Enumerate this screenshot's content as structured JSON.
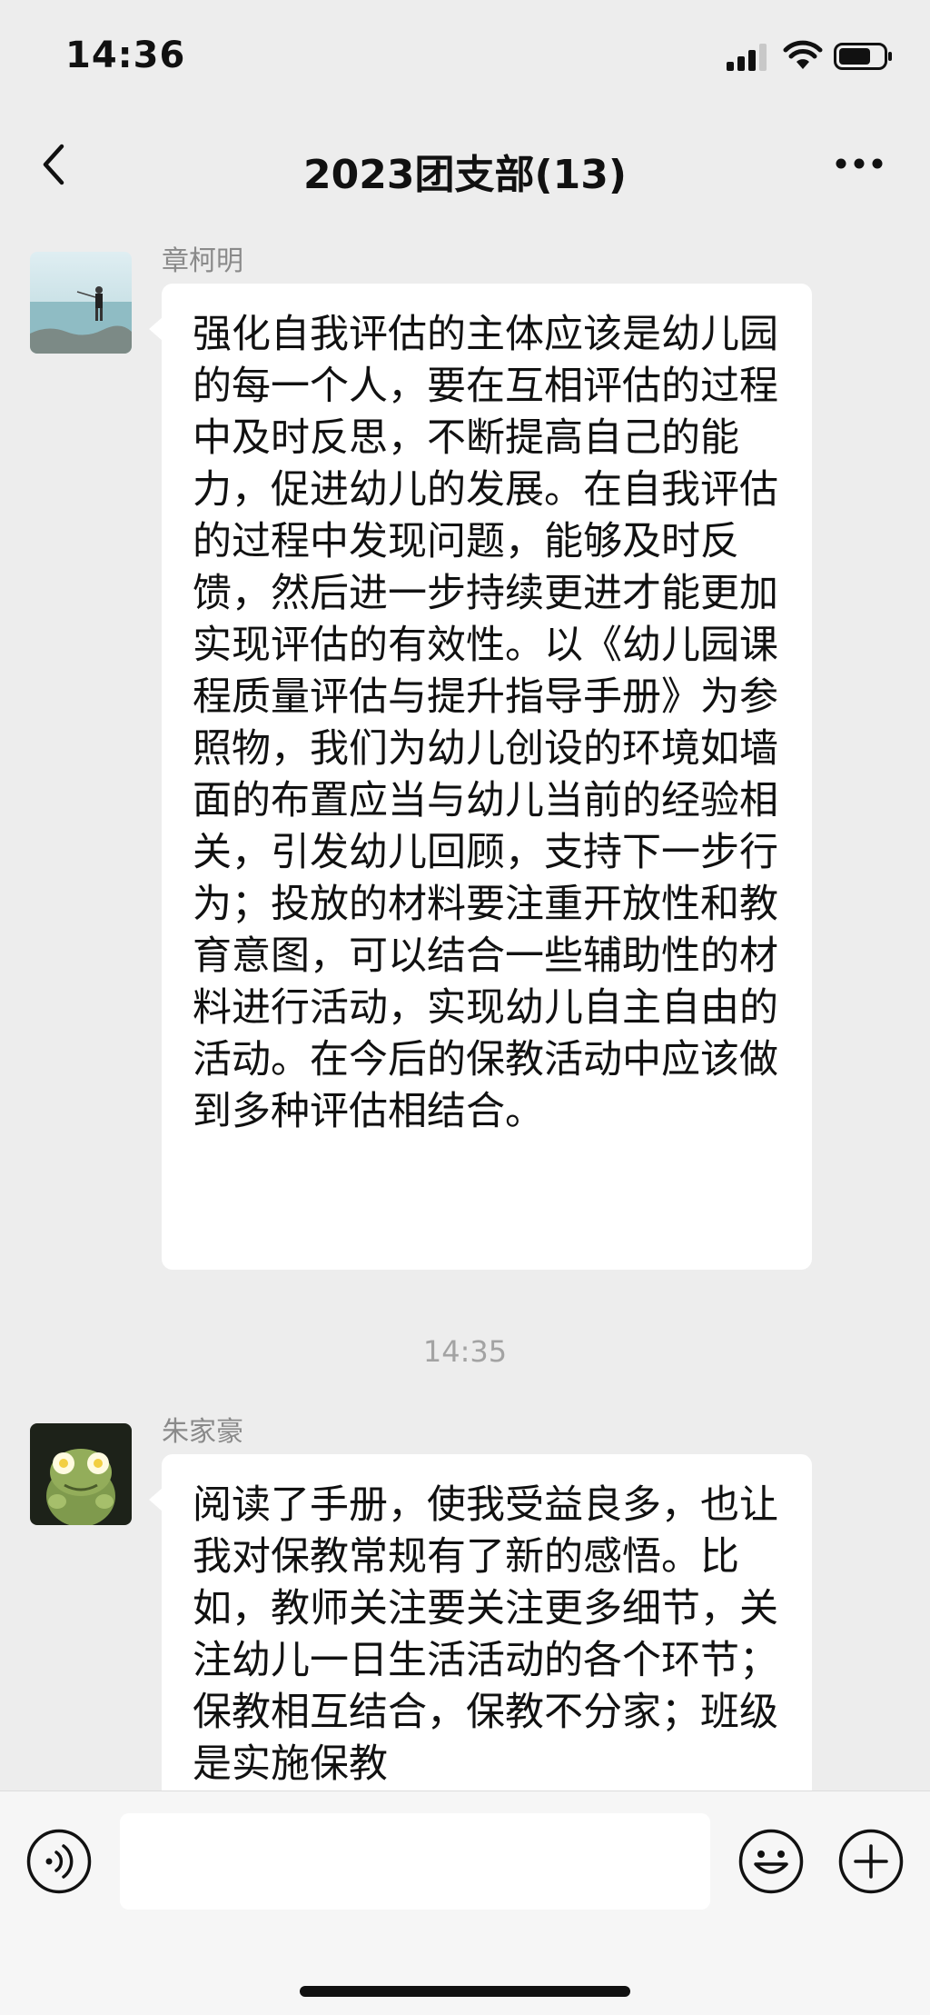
{
  "status_bar": {
    "time": "14:36"
  },
  "header": {
    "title": "2023团支部(13)"
  },
  "messages": [
    {
      "sender": "章柯明",
      "text": "强化自我评估的主体应该是幼儿园的每一个人，要在互相评估的过程中及时反思，不断提高自己的能力，促进幼儿的发展。在自我评估的过程中发现问题，能够及时反馈，然后进一步持续更进才能更加实现评估的有效性。以《幼儿园课程质量评估与提升指导手册》为参照物，我们为幼儿创设的环境如墙面的布置应当与幼儿当前的经验相关，引发幼儿回顾，支持下一步行为；投放的材料要注重开放性和教育意图，可以结合一些辅助性的材料进行活动，实现幼儿自主自由的活动。在今后的保教活动中应该做到多种评估相结合。"
    },
    {
      "sender": "朱家豪",
      "text": "阅读了手册，使我受益良多，也让我对保教常规有了新的感悟。比如，教师关注要关注更多细节，关注幼儿一日生活活动的各个环节；保教相互结合，保教不分家；班级是实施保教"
    }
  ],
  "timestamp": "14:35",
  "input_bar": {
    "placeholder": ""
  },
  "icons": {
    "back": "chevron-left-icon",
    "more": "more-dots-icon",
    "voice": "voice-icon",
    "emoji": "emoji-icon",
    "plus": "plus-icon"
  }
}
